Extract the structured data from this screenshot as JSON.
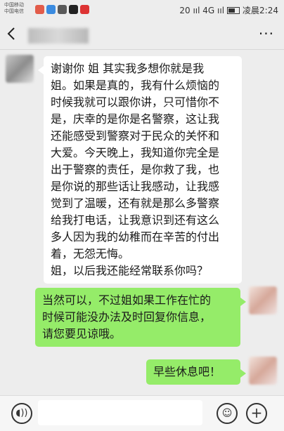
{
  "status_bar": {
    "carrier_line1": "中国移动",
    "carrier_line2": "中国电信",
    "signal_text": "20 ııl 4G ııl",
    "time": "凌晨2:24"
  },
  "header": {
    "back_icon": "chevron-left-icon",
    "more_icon": "more-dots-icon",
    "more_glyph": "···"
  },
  "messages": {
    "received_1": {
      "lines": [
        "谢谢你  姐  其实我多想你就是我",
        "姐。如果是真的，我有什么烦恼的",
        "时候我就可以跟你讲，只可惜你不",
        "是，庆幸的是你是名警察，这让我",
        "还能感受到警察对于民众的关怀和",
        "大爱。今天晚上，我知道你完全是",
        "出于警察的责任，是你救了我，也",
        "是你说的那些话让我感动，让我感",
        "觉到了温暖，还有就是那么多警察",
        "给我打电话，让我意识到还有这么",
        "多人因为我的幼稚而在辛苦的付出",
        "着，无怨无悔。",
        "姐，以后我还能经常联系你吗？"
      ]
    },
    "sent_1": {
      "lines": [
        "当然可以，不过姐如果工作在忙的",
        "时候可能没办法及时回复你信息，",
        "请您要见谅哦。"
      ]
    },
    "sent_2": {
      "lines": [
        "早些休息吧！"
      ]
    }
  },
  "input_bar": {
    "voice_icon": "voice-icon",
    "voice_glyph": "◖))",
    "emoji_icon": "emoji-icon",
    "emoji_glyph": "☺",
    "plus_icon": "plus-icon",
    "plus_glyph": "+"
  },
  "colors": {
    "background": "#ededed",
    "sent_bubble": "#95ec69",
    "received_bubble": "#ffffff"
  }
}
